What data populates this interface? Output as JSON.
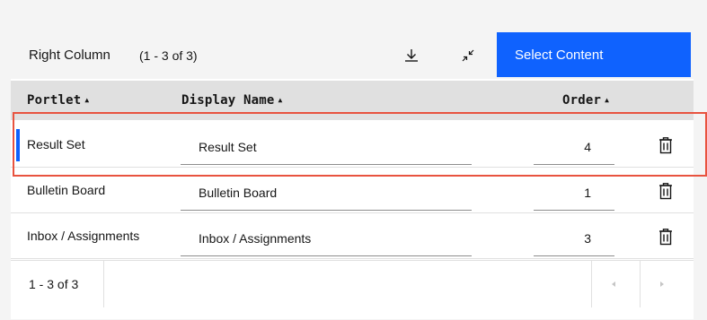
{
  "toolbar": {
    "title": "Right Column",
    "count": "(1 - 3 of 3)",
    "download_icon": "download-icon",
    "collapse_icon": "collapse-icon",
    "select_content_label": "Select Content"
  },
  "table": {
    "headers": {
      "portlet": "Portlet",
      "display_name": "Display Name",
      "order": "Order"
    },
    "rows": [
      {
        "portlet": "Result Set",
        "display_name": "Result Set",
        "order": "4",
        "selected": true
      },
      {
        "portlet": "Bulletin Board",
        "display_name": "Bulletin Board",
        "order": "1",
        "selected": false
      },
      {
        "portlet": "Inbox / Assignments",
        "display_name": "Inbox / Assignments",
        "order": "3",
        "selected": false
      }
    ]
  },
  "footer": {
    "range": "1 - 3 of 3",
    "prev_icon": "caret-left-icon",
    "next_icon": "caret-right-icon"
  },
  "colors": {
    "primary": "#0f62fe",
    "header_bg": "#e0e0e0",
    "toolbar_bg": "#f4f4f4",
    "highlight": "#e8533f"
  }
}
